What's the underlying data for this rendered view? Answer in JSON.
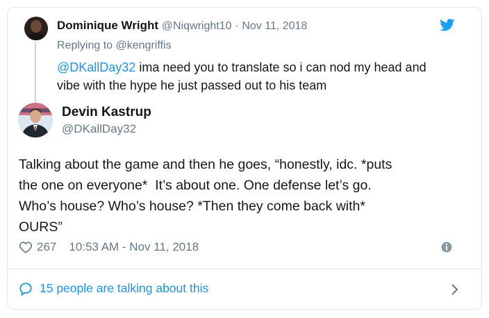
{
  "parent_tweet": {
    "name": "Dominique Wright",
    "handle": "@Niqwright10",
    "separator": "·",
    "date": "Nov 11, 2018",
    "replying_prefix": "Replying to",
    "replying_to": "@kengriffis",
    "mention": "@DKallDay32",
    "text_line1_rest": " ima need you to translate so i can nod my head and",
    "text_line2": "vibe with the hype he just passed out to his team"
  },
  "main_tweet": {
    "name": "Devin Kastrup",
    "handle": "@DKallDay32",
    "text_lines": [
      "Talking about the game and then he goes, “honestly, idc. *puts",
      "the one on everyone*  It’s about one. One defense let’s go.",
      "Who’s house? Who’s house? *Then they come back with*",
      "OURS”"
    ],
    "like_count": "267",
    "timestamp": "10:53 AM - Nov 11, 2018"
  },
  "conversation": {
    "label": "15 people are talking about this"
  },
  "icons": {
    "brand": "twitter-bird-icon",
    "like": "heart-icon",
    "info": "info-icon",
    "conversation": "speech-bubble-icon",
    "more": "chevron-right-icon"
  },
  "colors": {
    "accent": "#1b95e0",
    "bird": "#1da1f2",
    "muted": "#657786",
    "text": "#14171a",
    "border": "#e1e8ed"
  }
}
